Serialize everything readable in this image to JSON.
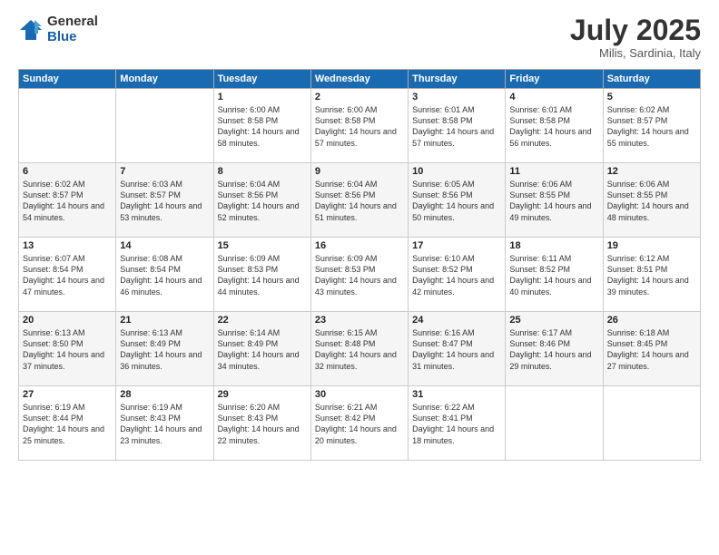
{
  "header": {
    "logo_general": "General",
    "logo_blue": "Blue",
    "month_title": "July 2025",
    "subtitle": "Milis, Sardinia, Italy"
  },
  "days_of_week": [
    "Sunday",
    "Monday",
    "Tuesday",
    "Wednesday",
    "Thursday",
    "Friday",
    "Saturday"
  ],
  "weeks": [
    [
      {
        "day": "",
        "text": ""
      },
      {
        "day": "",
        "text": ""
      },
      {
        "day": "1",
        "text": "Sunrise: 6:00 AM\nSunset: 8:58 PM\nDaylight: 14 hours and 58 minutes."
      },
      {
        "day": "2",
        "text": "Sunrise: 6:00 AM\nSunset: 8:58 PM\nDaylight: 14 hours and 57 minutes."
      },
      {
        "day": "3",
        "text": "Sunrise: 6:01 AM\nSunset: 8:58 PM\nDaylight: 14 hours and 57 minutes."
      },
      {
        "day": "4",
        "text": "Sunrise: 6:01 AM\nSunset: 8:58 PM\nDaylight: 14 hours and 56 minutes."
      },
      {
        "day": "5",
        "text": "Sunrise: 6:02 AM\nSunset: 8:57 PM\nDaylight: 14 hours and 55 minutes."
      }
    ],
    [
      {
        "day": "6",
        "text": "Sunrise: 6:02 AM\nSunset: 8:57 PM\nDaylight: 14 hours and 54 minutes."
      },
      {
        "day": "7",
        "text": "Sunrise: 6:03 AM\nSunset: 8:57 PM\nDaylight: 14 hours and 53 minutes."
      },
      {
        "day": "8",
        "text": "Sunrise: 6:04 AM\nSunset: 8:56 PM\nDaylight: 14 hours and 52 minutes."
      },
      {
        "day": "9",
        "text": "Sunrise: 6:04 AM\nSunset: 8:56 PM\nDaylight: 14 hours and 51 minutes."
      },
      {
        "day": "10",
        "text": "Sunrise: 6:05 AM\nSunset: 8:56 PM\nDaylight: 14 hours and 50 minutes."
      },
      {
        "day": "11",
        "text": "Sunrise: 6:06 AM\nSunset: 8:55 PM\nDaylight: 14 hours and 49 minutes."
      },
      {
        "day": "12",
        "text": "Sunrise: 6:06 AM\nSunset: 8:55 PM\nDaylight: 14 hours and 48 minutes."
      }
    ],
    [
      {
        "day": "13",
        "text": "Sunrise: 6:07 AM\nSunset: 8:54 PM\nDaylight: 14 hours and 47 minutes."
      },
      {
        "day": "14",
        "text": "Sunrise: 6:08 AM\nSunset: 8:54 PM\nDaylight: 14 hours and 46 minutes."
      },
      {
        "day": "15",
        "text": "Sunrise: 6:09 AM\nSunset: 8:53 PM\nDaylight: 14 hours and 44 minutes."
      },
      {
        "day": "16",
        "text": "Sunrise: 6:09 AM\nSunset: 8:53 PM\nDaylight: 14 hours and 43 minutes."
      },
      {
        "day": "17",
        "text": "Sunrise: 6:10 AM\nSunset: 8:52 PM\nDaylight: 14 hours and 42 minutes."
      },
      {
        "day": "18",
        "text": "Sunrise: 6:11 AM\nSunset: 8:52 PM\nDaylight: 14 hours and 40 minutes."
      },
      {
        "day": "19",
        "text": "Sunrise: 6:12 AM\nSunset: 8:51 PM\nDaylight: 14 hours and 39 minutes."
      }
    ],
    [
      {
        "day": "20",
        "text": "Sunrise: 6:13 AM\nSunset: 8:50 PM\nDaylight: 14 hours and 37 minutes."
      },
      {
        "day": "21",
        "text": "Sunrise: 6:13 AM\nSunset: 8:49 PM\nDaylight: 14 hours and 36 minutes."
      },
      {
        "day": "22",
        "text": "Sunrise: 6:14 AM\nSunset: 8:49 PM\nDaylight: 14 hours and 34 minutes."
      },
      {
        "day": "23",
        "text": "Sunrise: 6:15 AM\nSunset: 8:48 PM\nDaylight: 14 hours and 32 minutes."
      },
      {
        "day": "24",
        "text": "Sunrise: 6:16 AM\nSunset: 8:47 PM\nDaylight: 14 hours and 31 minutes."
      },
      {
        "day": "25",
        "text": "Sunrise: 6:17 AM\nSunset: 8:46 PM\nDaylight: 14 hours and 29 minutes."
      },
      {
        "day": "26",
        "text": "Sunrise: 6:18 AM\nSunset: 8:45 PM\nDaylight: 14 hours and 27 minutes."
      }
    ],
    [
      {
        "day": "27",
        "text": "Sunrise: 6:19 AM\nSunset: 8:44 PM\nDaylight: 14 hours and 25 minutes."
      },
      {
        "day": "28",
        "text": "Sunrise: 6:19 AM\nSunset: 8:43 PM\nDaylight: 14 hours and 23 minutes."
      },
      {
        "day": "29",
        "text": "Sunrise: 6:20 AM\nSunset: 8:43 PM\nDaylight: 14 hours and 22 minutes."
      },
      {
        "day": "30",
        "text": "Sunrise: 6:21 AM\nSunset: 8:42 PM\nDaylight: 14 hours and 20 minutes."
      },
      {
        "day": "31",
        "text": "Sunrise: 6:22 AM\nSunset: 8:41 PM\nDaylight: 14 hours and 18 minutes."
      },
      {
        "day": "",
        "text": ""
      },
      {
        "day": "",
        "text": ""
      }
    ]
  ]
}
